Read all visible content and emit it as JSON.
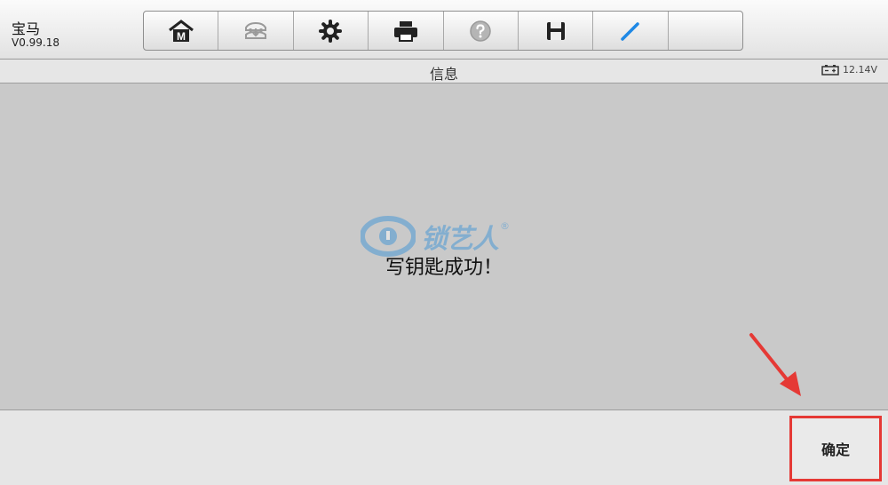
{
  "header": {
    "vehicle_name": "宝马",
    "version": "V0.99.18"
  },
  "toolbar": {
    "buttons": [
      {
        "icon": "home-icon",
        "letter": "M"
      },
      {
        "icon": "vehicle-swap-icon"
      },
      {
        "icon": "gear-icon"
      },
      {
        "icon": "printer-icon"
      },
      {
        "icon": "help-icon"
      },
      {
        "icon": "save-icon"
      },
      {
        "icon": "pen-icon"
      }
    ]
  },
  "page": {
    "title": "信息"
  },
  "status": {
    "battery_voltage": "12.14V"
  },
  "content": {
    "message": "写钥匙成功！",
    "watermark_text": "锁艺人",
    "watermark_mark": "®"
  },
  "footer": {
    "ok_label": "确定"
  },
  "colors": {
    "highlight": "#e53935",
    "accent": "#2f8ed8"
  }
}
